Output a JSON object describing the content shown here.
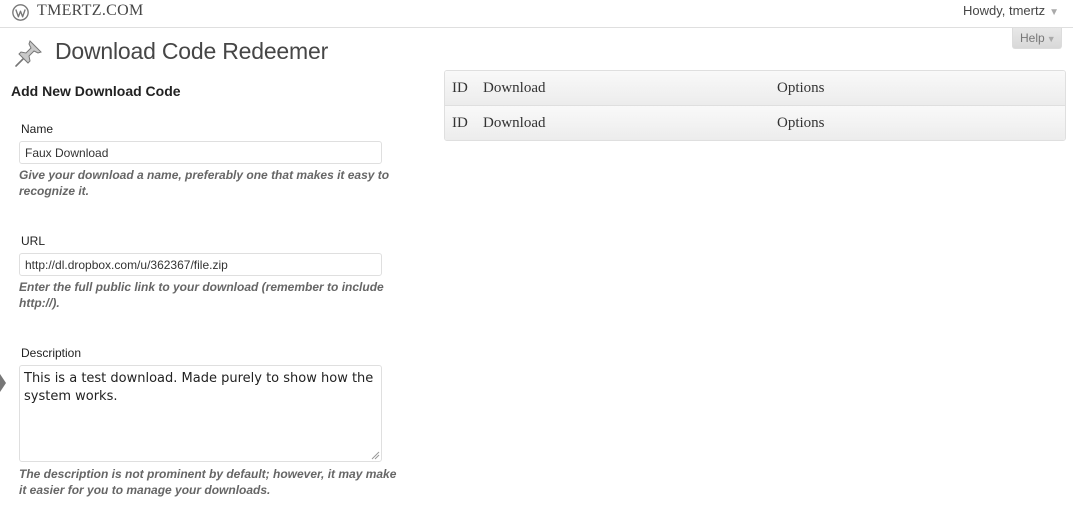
{
  "admin_bar": {
    "site_name": "TMERTZ.COM",
    "greeting": "Howdy, tmertz",
    "logo_icon": "wordpress-logo-icon",
    "menu_icon": "chevron-down-icon"
  },
  "help_tab": {
    "label": "Help",
    "icon": "chevron-down-icon"
  },
  "page": {
    "title": "Download Code Redeemer",
    "icon": "pushpin-icon"
  },
  "form": {
    "title": "Add New Download Code",
    "name": {
      "label": "Name",
      "value": "Faux Download",
      "hint": "Give your download a name, preferably one that makes it easy to recognize it."
    },
    "url": {
      "label": "URL",
      "value": "http://dl.dropbox.com/u/362367/file.zip",
      "hint": "Enter the full public link to your download (remember to include http://)."
    },
    "description": {
      "label": "Description",
      "value": "This is a test download. Made purely to show how the system works.",
      "hint": "The description is not prominent by default; however, it may make it easier for you to manage your downloads."
    }
  },
  "table": {
    "columns": [
      "ID",
      "Download",
      "Options"
    ]
  },
  "colors": {
    "border": "#dfdfdf",
    "header_bg": "#ececec",
    "hint_text": "#666666",
    "title_text": "#464646"
  }
}
